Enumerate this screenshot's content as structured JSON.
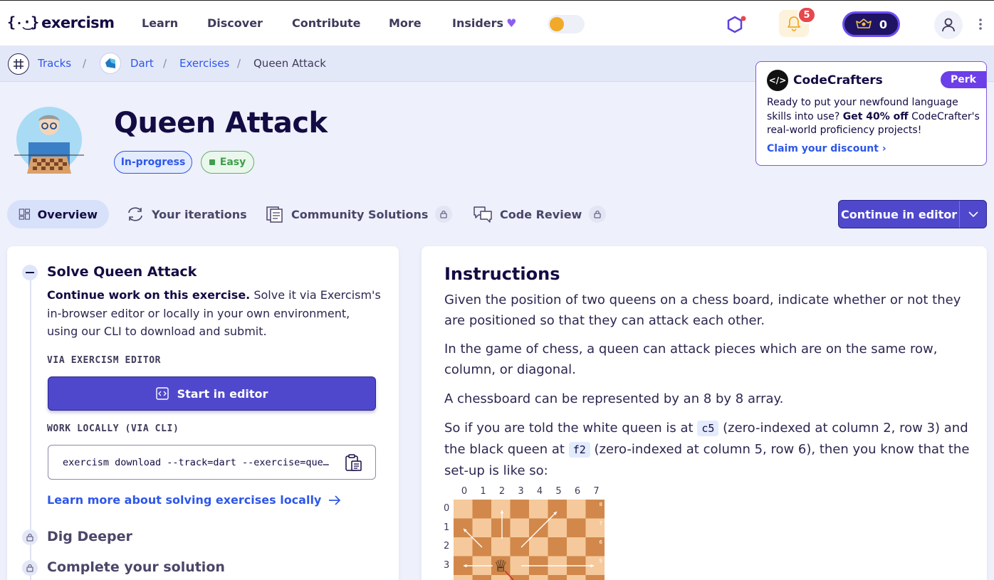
{
  "nav": {
    "logo_mark": "{·͜·}",
    "logo_text": "exercism",
    "links": [
      "Learn",
      "Discover",
      "Contribute",
      "More",
      "Insiders"
    ],
    "notifications_count": "5",
    "reputation": "0"
  },
  "breadcrumb": {
    "tracks": "Tracks",
    "track": "Dart",
    "exercises": "Exercises",
    "current": "Queen Attack",
    "separator": "/"
  },
  "perk": {
    "title": "CodeCrafters",
    "badge": "Perk",
    "text_1": "Ready to put your newfound language skills into use? ",
    "text_bold": "Get 40% off",
    "text_2": " CodeCrafter's real-world proficiency projects!",
    "link": "Claim your discount"
  },
  "exercise": {
    "title": "Queen Attack",
    "status": "In-progress",
    "difficulty": "Easy"
  },
  "tabs": [
    {
      "label": "Overview",
      "active": true
    },
    {
      "label": "Your iterations"
    },
    {
      "label": "Community Solutions",
      "locked": true
    },
    {
      "label": "Code Review",
      "locked": true
    }
  ],
  "continue_button": "Continue in editor",
  "solve": {
    "title": "Solve Queen Attack",
    "desc_bold": "Continue work on this exercise.",
    "desc_rest": " Solve it via Exercism's in-browser editor or locally in your own environment, using our CLI to download and submit.",
    "via_editor_label": "VIA EXERCISM EDITOR",
    "start_button": "Start in editor",
    "via_cli_label": "WORK LOCALLY (VIA CLI)",
    "cli_command": "exercism download --track=dart --exercise=queen-attack",
    "learn_more": "Learn more about solving exercises locally"
  },
  "steps": {
    "dig_deeper": "Dig Deeper",
    "complete": "Complete your solution"
  },
  "instructions": {
    "title": "Instructions",
    "p1": "Given the position of two queens on a chess board, indicate whether or not they are positioned so that they can attack each other.",
    "p2": "In the game of chess, a queen can attack pieces which are on the same row, column, or diagonal.",
    "p3": "A chessboard can be represented by an 8 by 8 array.",
    "p4_a": "So if you are told the white queen is at ",
    "p4_code1": "c5",
    "p4_b": " (zero-indexed at column 2, row 3) and the black queen at ",
    "p4_code2": "f2",
    "p4_c": " (zero-indexed at column 5, row 6), then you know that the set-up is like so:"
  },
  "board": {
    "col_labels": [
      "0",
      "1",
      "2",
      "3",
      "4",
      "5",
      "6",
      "7"
    ],
    "row_labels": [
      "0",
      "1",
      "2",
      "3"
    ],
    "edge_labels": [
      "8",
      "7",
      "6",
      "5"
    ],
    "queen_glyph": "♕",
    "light_color": "#f5c99b",
    "dark_color": "#d1884a"
  },
  "colors": {
    "accent": "#4f48cc",
    "link": "#2e57e8",
    "perk": "#6c3fe8"
  }
}
